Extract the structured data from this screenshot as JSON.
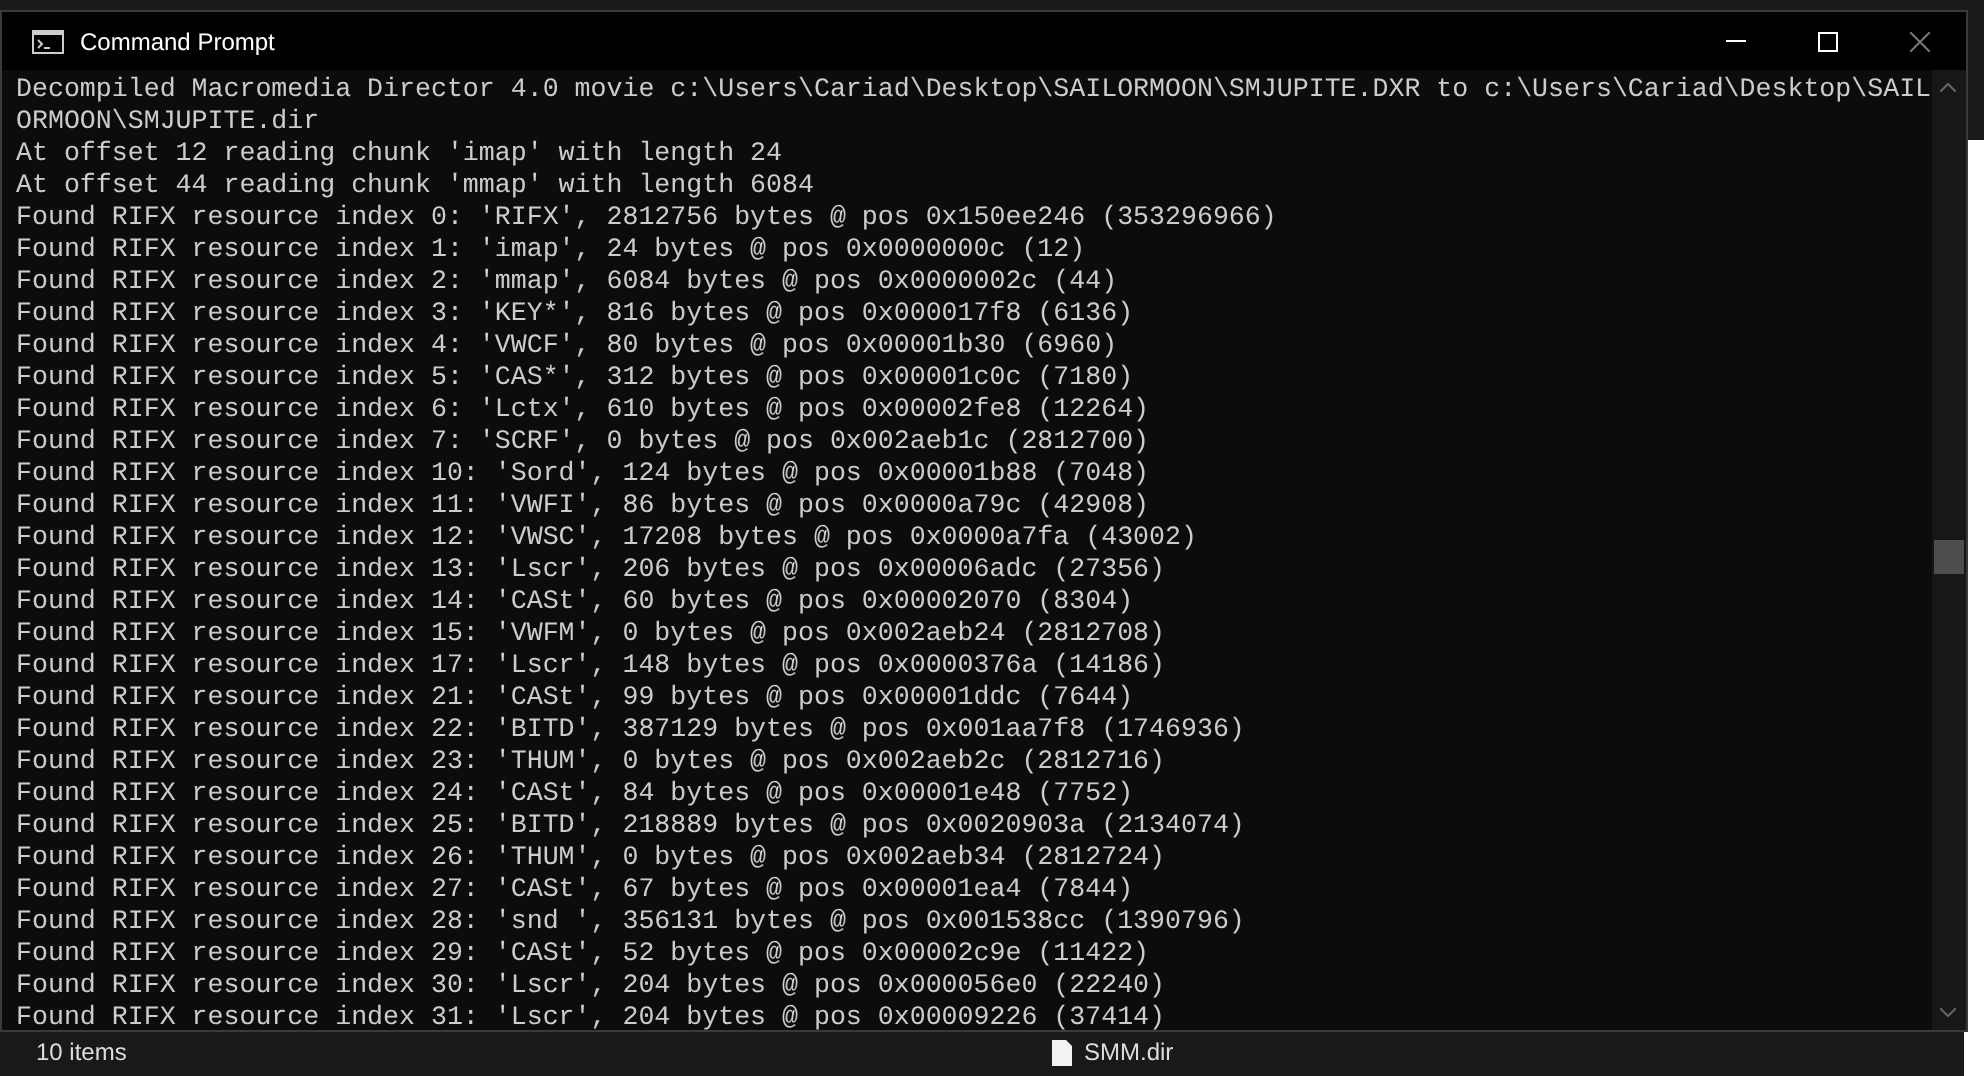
{
  "window": {
    "title": "Command Prompt"
  },
  "console": {
    "lines": [
      "Decompiled Macromedia Director 4.0 movie c:\\Users\\Cariad\\Desktop\\SAILORMOON\\SMJUPITE.DXR to c:\\Users\\Cariad\\Desktop\\SAIL",
      "ORMOON\\SMJUPITE.dir",
      "At offset 12 reading chunk 'imap' with length 24",
      "At offset 44 reading chunk 'mmap' with length 6084",
      "Found RIFX resource index 0: 'RIFX', 2812756 bytes @ pos 0x150ee246 (353296966)",
      "Found RIFX resource index 1: 'imap', 24 bytes @ pos 0x0000000c (12)",
      "Found RIFX resource index 2: 'mmap', 6084 bytes @ pos 0x0000002c (44)",
      "Found RIFX resource index 3: 'KEY*', 816 bytes @ pos 0x000017f8 (6136)",
      "Found RIFX resource index 4: 'VWCF', 80 bytes @ pos 0x00001b30 (6960)",
      "Found RIFX resource index 5: 'CAS*', 312 bytes @ pos 0x00001c0c (7180)",
      "Found RIFX resource index 6: 'Lctx', 610 bytes @ pos 0x00002fe8 (12264)",
      "Found RIFX resource index 7: 'SCRF', 0 bytes @ pos 0x002aeb1c (2812700)",
      "Found RIFX resource index 10: 'Sord', 124 bytes @ pos 0x00001b88 (7048)",
      "Found RIFX resource index 11: 'VWFI', 86 bytes @ pos 0x0000a79c (42908)",
      "Found RIFX resource index 12: 'VWSC', 17208 bytes @ pos 0x0000a7fa (43002)",
      "Found RIFX resource index 13: 'Lscr', 206 bytes @ pos 0x00006adc (27356)",
      "Found RIFX resource index 14: 'CASt', 60 bytes @ pos 0x00002070 (8304)",
      "Found RIFX resource index 15: 'VWFM', 0 bytes @ pos 0x002aeb24 (2812708)",
      "Found RIFX resource index 17: 'Lscr', 148 bytes @ pos 0x0000376a (14186)",
      "Found RIFX resource index 21: 'CASt', 99 bytes @ pos 0x00001ddc (7644)",
      "Found RIFX resource index 22: 'BITD', 387129 bytes @ pos 0x001aa7f8 (1746936)",
      "Found RIFX resource index 23: 'THUM', 0 bytes @ pos 0x002aeb2c (2812716)",
      "Found RIFX resource index 24: 'CASt', 84 bytes @ pos 0x00001e48 (7752)",
      "Found RIFX resource index 25: 'BITD', 218889 bytes @ pos 0x0020903a (2134074)",
      "Found RIFX resource index 26: 'THUM', 0 bytes @ pos 0x002aeb34 (2812724)",
      "Found RIFX resource index 27: 'CASt', 67 bytes @ pos 0x00001ea4 (7844)",
      "Found RIFX resource index 28: 'snd ', 356131 bytes @ pos 0x001538cc (1390796)",
      "Found RIFX resource index 29: 'CASt', 52 bytes @ pos 0x00002c9e (11422)",
      "Found RIFX resource index 30: 'Lscr', 204 bytes @ pos 0x000056e0 (22240)",
      "Found RIFX resource index 31: 'Lscr', 204 bytes @ pos 0x00009226 (37414)"
    ]
  },
  "explorer": {
    "status": "10 items",
    "file": "SMM.dir"
  }
}
